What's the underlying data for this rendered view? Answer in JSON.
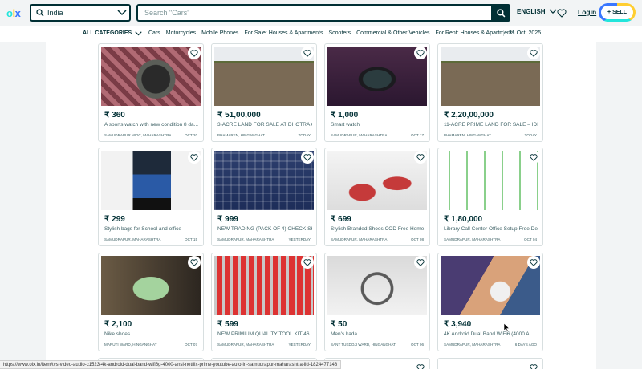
{
  "header": {
    "logo": "olx",
    "location_value": "India",
    "search_placeholder": "Search \"Cars\"",
    "language": "ENGLISH",
    "login_label": "Login",
    "sell_label": "SELL"
  },
  "categories": {
    "all_label": "ALL CATEGORIES",
    "links": [
      "Cars",
      "Motorcycles",
      "Mobile Phones",
      "For Sale: Houses & Apartments",
      "Scooters",
      "Commercial & Other Vehicles",
      "For Rent: Houses & Apartments"
    ],
    "date": "31 Oct, 2025"
  },
  "listings": [
    {
      "price": "₹ 360",
      "title": "A sports watch with new condition 8 da...",
      "location": "Samudrapur MIDC, Maharashtra",
      "date": "Oct 20",
      "image": "watch"
    },
    {
      "price": "₹ 51,00,000",
      "title": "3-ACRE LAND FOR SALE AT DHOTRA C...",
      "location": "Bhamaren, Hinganghat",
      "date": "Today",
      "image": "field"
    },
    {
      "price": "₹ 1,000",
      "title": "Smart watch",
      "location": "Samudrapur, Maharashtra",
      "date": "Oct 17",
      "image": "smartwatch"
    },
    {
      "price": "₹ 2,20,00,000",
      "title": "11-ACRE PRIME LAND FOR SALE – IDE...",
      "location": "Bhamaren, Hinganghat",
      "date": "Today",
      "image": "field"
    },
    {
      "price": "₹ 299",
      "title": "Stylish bags for School and office",
      "location": "Samudrapur, Maharashtra",
      "date": "Oct 15",
      "image": "bag"
    },
    {
      "price": "₹ 999",
      "title": "NEW TRADING (PACK OF 4) CHECK SH...",
      "location": "Samudrapur, Maharashtra",
      "date": "Yesterday",
      "image": "shirt"
    },
    {
      "price": "₹ 699",
      "title": "Stylish Branded Shoes COD Free Home...",
      "location": "Samudrapur, Maharashtra",
      "date": "Oct 08",
      "image": "shoes"
    },
    {
      "price": "₹ 1,80,000",
      "title": "Library Call Center Office Setup Free De...",
      "location": "Samudrapur, Maharashtra",
      "date": "Oct 04",
      "image": "office"
    },
    {
      "price": "₹ 2,100",
      "title": "Nike shoes",
      "location": "Maruti Ward, Hinganghat",
      "date": "Oct 07",
      "image": "nike"
    },
    {
      "price": "₹ 599",
      "title": "NEW PRIMIUM QUALITY TOOL KIT 46 ...",
      "location": "Samudrapur, Maharashtra",
      "date": "Yesterday",
      "image": "tools"
    },
    {
      "price": "₹ 50",
      "title": "Men's kada",
      "location": "Sant Tukdoji Ward, Hinganghat",
      "date": "Oct 06",
      "image": "kada"
    },
    {
      "price": "₹ 3,940",
      "title": "4K Android Dual Band WiFi6 (4000 A...",
      "location": "Samudrapur, Maharashtra",
      "date": "6 days ago",
      "image": "projector"
    }
  ],
  "status_url": "https://www.olx.in/item/tvs-video-audio-c1523-4k-android-dual-band-wifi6g-4000-ansi-netflix-prime-youtube-auto-in-samudrapur-maharashtra-iid-1824477148"
}
